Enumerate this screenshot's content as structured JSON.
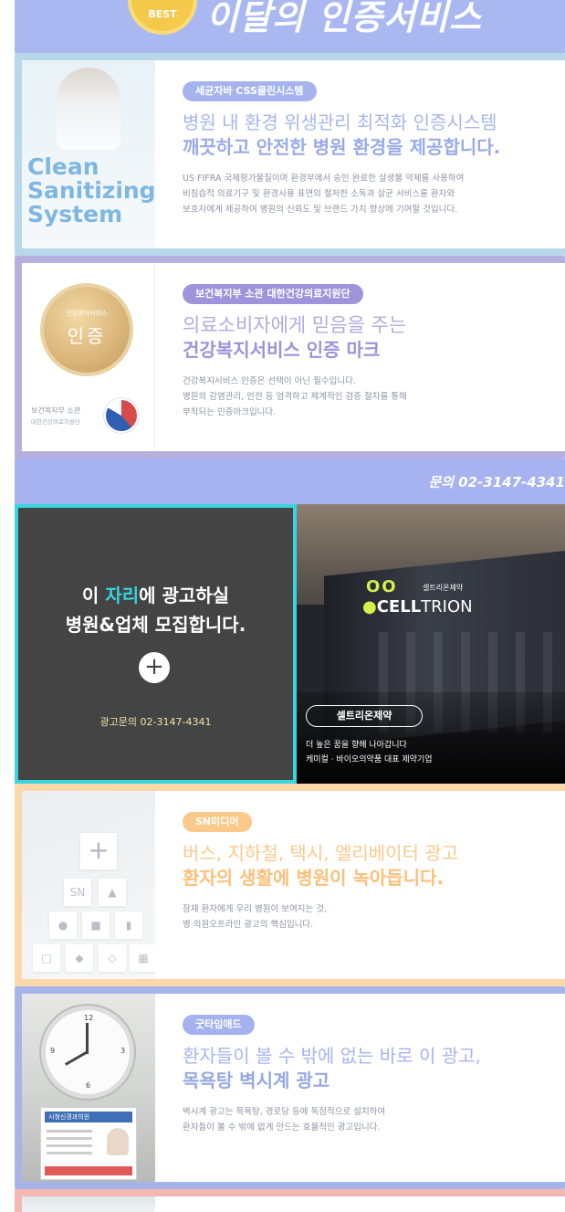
{
  "header": {
    "badge": "BEST",
    "title": "이달의 인증서비스"
  },
  "cards": [
    {
      "key": "clean",
      "pill": "세균자바 CSS클린시스템",
      "headline1": "병원 내 환경 위생관리 최적화 인증시스템",
      "headline2": "깨끗하고 안전한 병원 환경을 제공합니다.",
      "desc": [
        "US FIFRA 국제평가물질이며 환경부에서 승인 완료한 살생물 약제를 사용하여",
        "비침습적 의료기구 및 환경사용 표면의 철저한 소독과 살균 서비스를 환자와",
        "보호자에게 제공하여 병원의 신뢰도 및 브랜드 가치 향상에 기여할 것입니다."
      ],
      "image_words": [
        "Clean",
        "Sanitizing",
        "System"
      ]
    },
    {
      "key": "cert",
      "pill": "보건복지부 소관 대한건강의료지원단",
      "headline1": "의료소비자에게 믿음을 주는",
      "headline2": "건강복지서비스 인증 마크",
      "desc": [
        "건강복지서비스 인증은 선택이 아닌 필수입니다.",
        "병원의 감염관리, 안전 등 엄격하고 체계적인 검증 절차를 통해",
        "부착되는 인증마크입니다."
      ],
      "medal_top": "건강복지서비스",
      "medal_main": "인증",
      "org_line1": "보건복지부 소관",
      "org_line2": "대한건강의료지원단"
    },
    {
      "key": "sn",
      "pill": "SN미디어",
      "headline1": "버스, 지하철, 택시, 엘리베이터 광고",
      "headline2": "환자의 생활에 병원이 녹아듭니다.",
      "desc": [
        "잠재 환자에게 우리 병원이 보여지는 것,",
        "병·의원오프라인 광고의 핵심입니다."
      ],
      "block_sn": "SN"
    },
    {
      "key": "good",
      "pill": "굿타임애드",
      "headline1": "환자들이 볼 수 밖에 없는 바로 이 광고,",
      "headline2": "목욕탕 벽시계 광고",
      "desc": [
        "벽시계 광고는 목욕탕, 경로당 등에 독점적으로 설치하여",
        "환자들이 볼 수 밖에 없게 만드는 효율적인 광고입니다."
      ],
      "poster_head": "시청신경과의원"
    }
  ],
  "contact_strip": "문의 02-3147-4341",
  "ad_slot": {
    "line1_pre": "이 ",
    "line1_highlight": "자리",
    "line1_post": "에 광고하실",
    "line2": "병원&업체 모집합니다.",
    "plus": "+",
    "tel": "광고문의 02-3147-4341"
  },
  "celltrion": {
    "rings": "OO",
    "logo_kr": "셀트리온제약",
    "logo_en_bold": "CELL",
    "logo_en_light": "TRION",
    "pill": "셀트리온제약",
    "caption1": "더 높은 꿈을 향해 나아갑니다",
    "caption2": "케미컬 · 바이오의약품 대표 제약기업"
  },
  "colors": {
    "accent_cyan": "#37d6de",
    "clean_blue": "#a6b6ee",
    "cert_purple": "#9e94dc",
    "sn_orange": "#fbc07a",
    "good_blue": "#95a8e6"
  }
}
